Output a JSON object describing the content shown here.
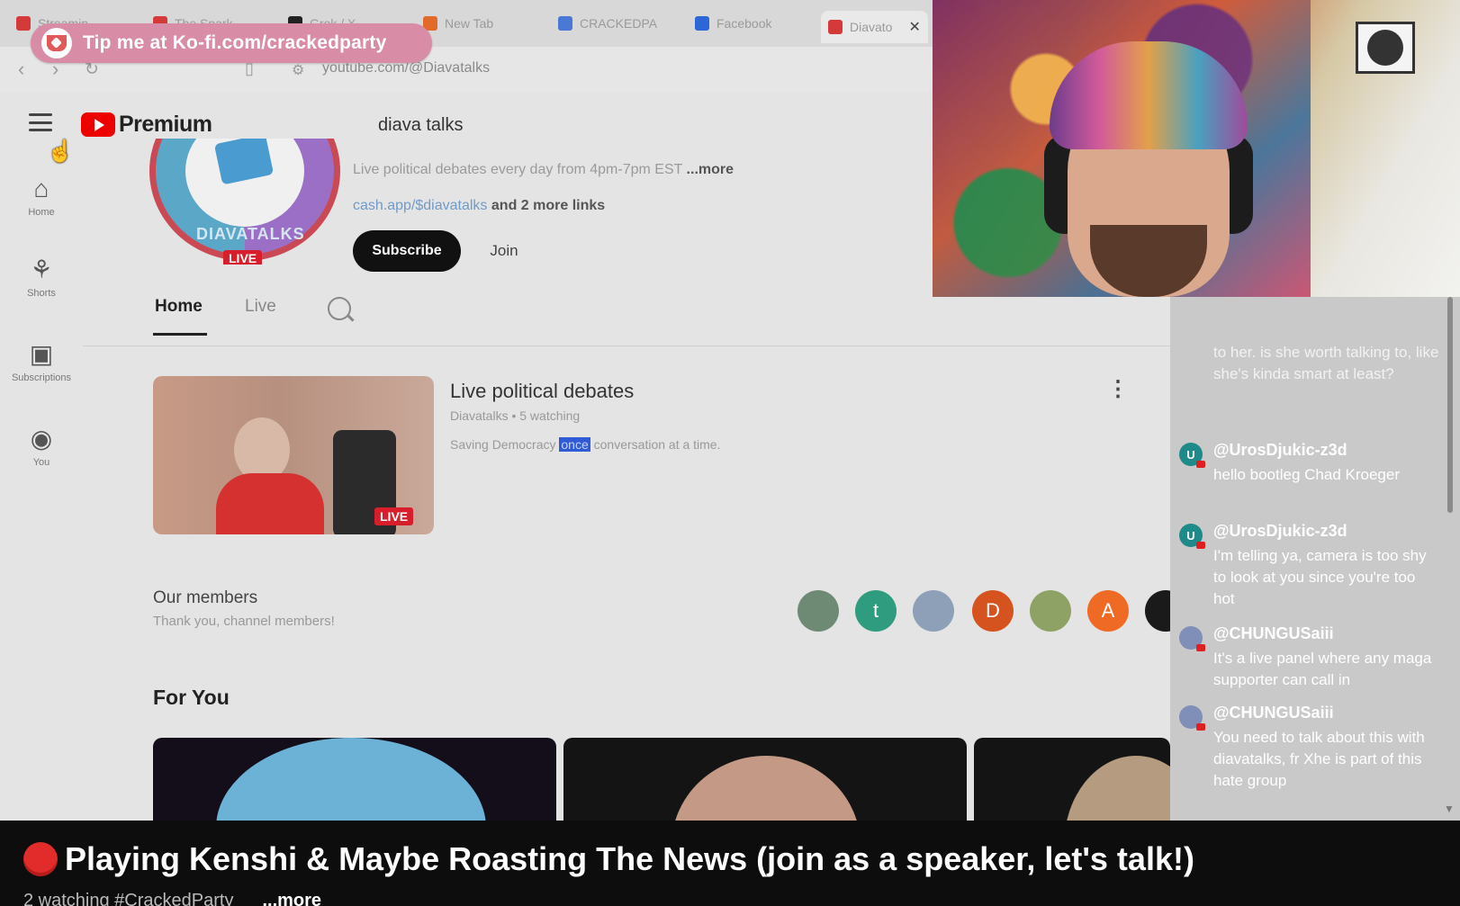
{
  "tabs": [
    {
      "label": "Streamin",
      "color": "#d43a3a"
    },
    {
      "label": "The Spark",
      "color": "#d43a3a"
    },
    {
      "label": "Grok / X",
      "color": "#222222"
    },
    {
      "label": "New Tab",
      "color": "#e26b2b"
    },
    {
      "label": "CRACKEDPA",
      "color": "#4a78d4"
    },
    {
      "label": "Facebook",
      "color": "#2f66d6"
    },
    {
      "label": "Diavato",
      "color": "#d43a3a"
    }
  ],
  "address": {
    "url": "youtube.com/@Diavatalks"
  },
  "kofi": {
    "text": "Tip me at Ko-fi.com/crackedparty"
  },
  "youtube": {
    "logo_text": "Premium",
    "search_value": "diava talks",
    "sidebar": [
      {
        "label": "Home",
        "icon": "home-icon",
        "glyph": "⌂"
      },
      {
        "label": "Shorts",
        "icon": "shorts-icon",
        "glyph": "⚘"
      },
      {
        "label": "Subscriptions",
        "icon": "subscriptions-icon",
        "glyph": "▣"
      },
      {
        "label": "You",
        "icon": "you-icon",
        "glyph": "◉"
      }
    ],
    "channel": {
      "avatar_text": "DIAVATALKS",
      "live_badge": "LIVE",
      "description": "Live political debates every day from 4pm-7pm EST",
      "description_more": "...more",
      "link": "cash.app/$diavatalks",
      "more_links": "and 2 more links",
      "subscribe_label": "Subscribe",
      "join_label": "Join"
    },
    "channel_tabs": [
      "Home",
      "Live"
    ],
    "video": {
      "title": "Live political debates",
      "meta": "Diavatalks • 5 watching",
      "desc_before": "Saving Democracy ",
      "desc_highlight": "once",
      "desc_after": " conversation at a time.",
      "live_label": "LIVE"
    },
    "members": {
      "title": "Our members",
      "subtitle": "Thank you, channel members!",
      "avatars": [
        {
          "letter": "",
          "color": "#6f8a74"
        },
        {
          "letter": "t",
          "color": "#2f9c7f"
        },
        {
          "letter": "",
          "color": "#8da0b8"
        },
        {
          "letter": "D",
          "color": "#d5531f"
        },
        {
          "letter": "",
          "color": "#8fa266"
        },
        {
          "letter": "A",
          "color": "#ef6a25"
        },
        {
          "letter": "",
          "color": "#1a1a1a"
        }
      ]
    },
    "for_you": "For You"
  },
  "chat": {
    "faded_message": "to her. is she worth talking to, like she's kinda smart at least?",
    "messages": [
      {
        "author": "@UrosDjukic-z3d",
        "avatar_letter": "U",
        "avatar_color": "#1f8a8a",
        "text": "hello bootleg Chad Kroeger"
      },
      {
        "author": "@UrosDjukic-z3d",
        "avatar_letter": "U",
        "avatar_color": "#1f8a8a",
        "text": "I'm telling ya, camera is too shy to look at you since you're too hot"
      },
      {
        "author": "@CHUNGUSaiii",
        "avatar_letter": "",
        "avatar_color": "#7f8fb8",
        "text": "It's a live panel where any maga supporter can call in"
      },
      {
        "author": "@CHUNGUSaiii",
        "avatar_letter": "",
        "avatar_color": "#7f8fb8",
        "text": "You need to talk about this with diavatalks, fr Xhe is part of this hate group"
      }
    ]
  },
  "stream": {
    "title": "Playing Kenshi & Maybe Roasting The News (join as a speaker, let's talk!)",
    "meta": "2 watching  #CrackedParty",
    "more": "...more"
  }
}
